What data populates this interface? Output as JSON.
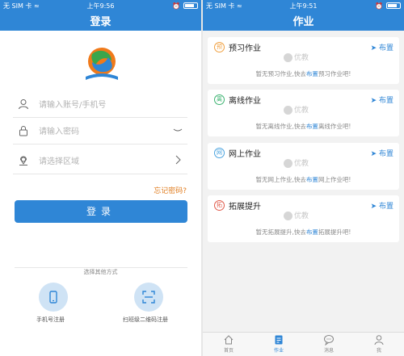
{
  "left_screen": {
    "status": {
      "carrier": "无 SIM 卡 ≈",
      "time": "上午9:56"
    },
    "title": "登录",
    "fields": [
      {
        "placeholder": "请输入账号/手机号",
        "icon": "user-icon"
      },
      {
        "placeholder": "请输入密码",
        "icon": "lock-icon"
      },
      {
        "placeholder": "请选择区域",
        "icon": "location-icon"
      }
    ],
    "forgot_password": "忘记密码?",
    "login_button": "登录",
    "other_methods_label": "选择其他方式",
    "register_options": [
      {
        "label": "手机号注册",
        "icon": "phone-icon"
      },
      {
        "label": "扫班级二维码注册",
        "icon": "qr-scan-icon"
      }
    ]
  },
  "right_screen": {
    "status": {
      "carrier": "无 SIM 卡 ≈",
      "time": "上午9:51"
    },
    "title": "作业",
    "assign_label": "布置",
    "watermark": "优教",
    "cards": [
      {
        "badge": "预",
        "badge_color": "#f0a040",
        "title": "预习作业",
        "empty_prefix": "暂无预习作业,快去",
        "empty_link": "布置",
        "empty_suffix": "预习作业吧!"
      },
      {
        "badge": "离",
        "badge_color": "#3cb371",
        "title": "离线作业",
        "empty_prefix": "暂无离线作业,快去",
        "empty_link": "布置",
        "empty_suffix": "离线作业吧!"
      },
      {
        "badge": "网",
        "badge_color": "#4aa3df",
        "title": "网上作业",
        "empty_prefix": "暂无网上作业,快去",
        "empty_link": "布置",
        "empty_suffix": "网上作业吧!"
      },
      {
        "badge": "拓",
        "badge_color": "#e05a4a",
        "title": "拓展提升",
        "empty_prefix": "暂无拓展提升,快去",
        "empty_link": "布置",
        "empty_suffix": "拓展提升吧!"
      }
    ],
    "tabs": [
      {
        "label": "首页",
        "icon": "home-icon",
        "active": false
      },
      {
        "label": "作业",
        "icon": "homework-icon",
        "active": true
      },
      {
        "label": "消息",
        "icon": "message-icon",
        "active": false
      },
      {
        "label": "我",
        "icon": "profile-icon",
        "active": false
      }
    ]
  },
  "colors": {
    "primary": "#2f86d6",
    "forgot": "#e07d20",
    "background": "#f2f2f2"
  }
}
